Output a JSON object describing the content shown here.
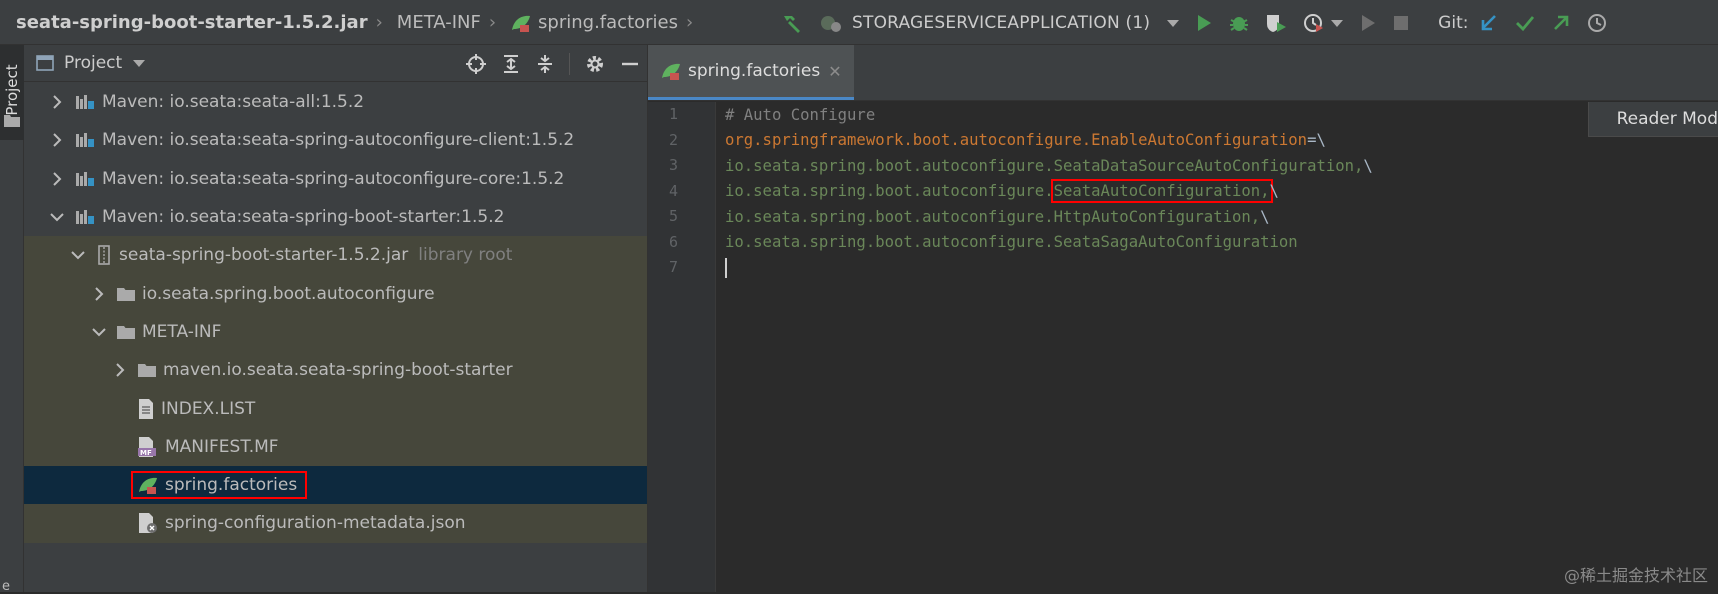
{
  "breadcrumb": {
    "items": [
      "seata-spring-boot-starter-1.5.2.jar",
      "META-INF",
      "spring.factories"
    ]
  },
  "toolbar": {
    "run_config": "STORAGESERVICEAPPLICATION (1)",
    "git_label": "Git:",
    "icons": [
      "hammer-icon",
      "run-config-icon",
      "dropdown-icon",
      "run-icon",
      "debug-icon",
      "coverage-icon",
      "profile-icon",
      "dropdown-icon",
      "attach-icon",
      "stop-icon",
      "git-update-icon",
      "git-commit-icon",
      "git-push-icon",
      "history-icon"
    ]
  },
  "left_strip": {
    "project_label": "Project",
    "bottom_label": "e"
  },
  "project_panel": {
    "title": "Project",
    "tree": [
      {
        "label": "Maven: io.seata:seata-all:1.5.2",
        "indent": 0,
        "icon": "maven-library-icon",
        "expand": "collapsed"
      },
      {
        "label": "Maven: io.seata:seata-spring-autoconfigure-client:1.5.2",
        "indent": 0,
        "icon": "maven-library-icon",
        "expand": "collapsed"
      },
      {
        "label": "Maven: io.seata:seata-spring-autoconfigure-core:1.5.2",
        "indent": 0,
        "icon": "maven-library-icon",
        "expand": "collapsed"
      },
      {
        "label": "Maven: io.seata:seata-spring-boot-starter:1.5.2",
        "indent": 0,
        "icon": "maven-library-icon",
        "expand": "expanded"
      },
      {
        "label": "seata-spring-boot-starter-1.5.2.jar",
        "suffix": "library root",
        "indent": 1,
        "icon": "jar-icon",
        "expand": "expanded"
      },
      {
        "label": "io.seata.spring.boot.autoconfigure",
        "indent": 2,
        "icon": "folder-icon",
        "expand": "collapsed"
      },
      {
        "label": "META-INF",
        "indent": 2,
        "icon": "folder-icon",
        "expand": "expanded"
      },
      {
        "label": "maven.io.seata.seata-spring-boot-starter",
        "indent": 3,
        "icon": "folder-icon",
        "expand": "collapsed"
      },
      {
        "label": "INDEX.LIST",
        "indent": 3,
        "icon": "text-file-icon",
        "expand": "none"
      },
      {
        "label": "MANIFEST.MF",
        "indent": 3,
        "icon": "manifest-file-icon",
        "expand": "none"
      },
      {
        "label": "spring.factories",
        "indent": 3,
        "icon": "spring-file-icon",
        "expand": "none",
        "selected": true,
        "highlighted": true
      },
      {
        "label": "spring-configuration-metadata.json",
        "indent": 3,
        "icon": "json-file-icon",
        "expand": "none"
      }
    ]
  },
  "editor": {
    "tab": {
      "label": "spring.factories"
    },
    "reader_mode": "Reader Mod",
    "lines": [
      {
        "number": "1",
        "segments": [
          {
            "t": "# Auto Configure",
            "c": "comment"
          }
        ]
      },
      {
        "number": "2",
        "segments": [
          {
            "t": "org.springframework.boot.autoconfigure.EnableAutoConfiguration",
            "c": "key"
          },
          {
            "t": "=\\",
            "c": "plain"
          }
        ]
      },
      {
        "number": "3",
        "segments": [
          {
            "t": "io.seata.spring.boot.autoconfigure.SeataDataSourceAutoConfiguration,",
            "c": "val"
          },
          {
            "t": "\\",
            "c": "plain"
          }
        ]
      },
      {
        "number": "4",
        "segments": [
          {
            "t": "io.seata.spring.boot.autoconfigure.",
            "c": "val"
          },
          {
            "t": "SeataAutoConfiguration,",
            "c": "val",
            "highlight": true
          },
          {
            "t": "\\",
            "c": "plain"
          }
        ]
      },
      {
        "number": "5",
        "segments": [
          {
            "t": "io.seata.spring.boot.autoconfigure.HttpAutoConfiguration,",
            "c": "val"
          },
          {
            "t": "\\",
            "c": "plain"
          }
        ]
      },
      {
        "number": "6",
        "segments": [
          {
            "t": "io.seata.spring.boot.autoconfigure.SeataSagaAutoConfiguration",
            "c": "val"
          }
        ]
      },
      {
        "number": "7",
        "segments": [],
        "caret": true
      }
    ]
  },
  "watermark": "@稀土掘金技术社区",
  "colors": {
    "selection": "#0d293e",
    "library_row": "#46473b",
    "highlight_box": "#ff0000",
    "run_green": "#499c54",
    "git_blue": "#3592c4"
  }
}
